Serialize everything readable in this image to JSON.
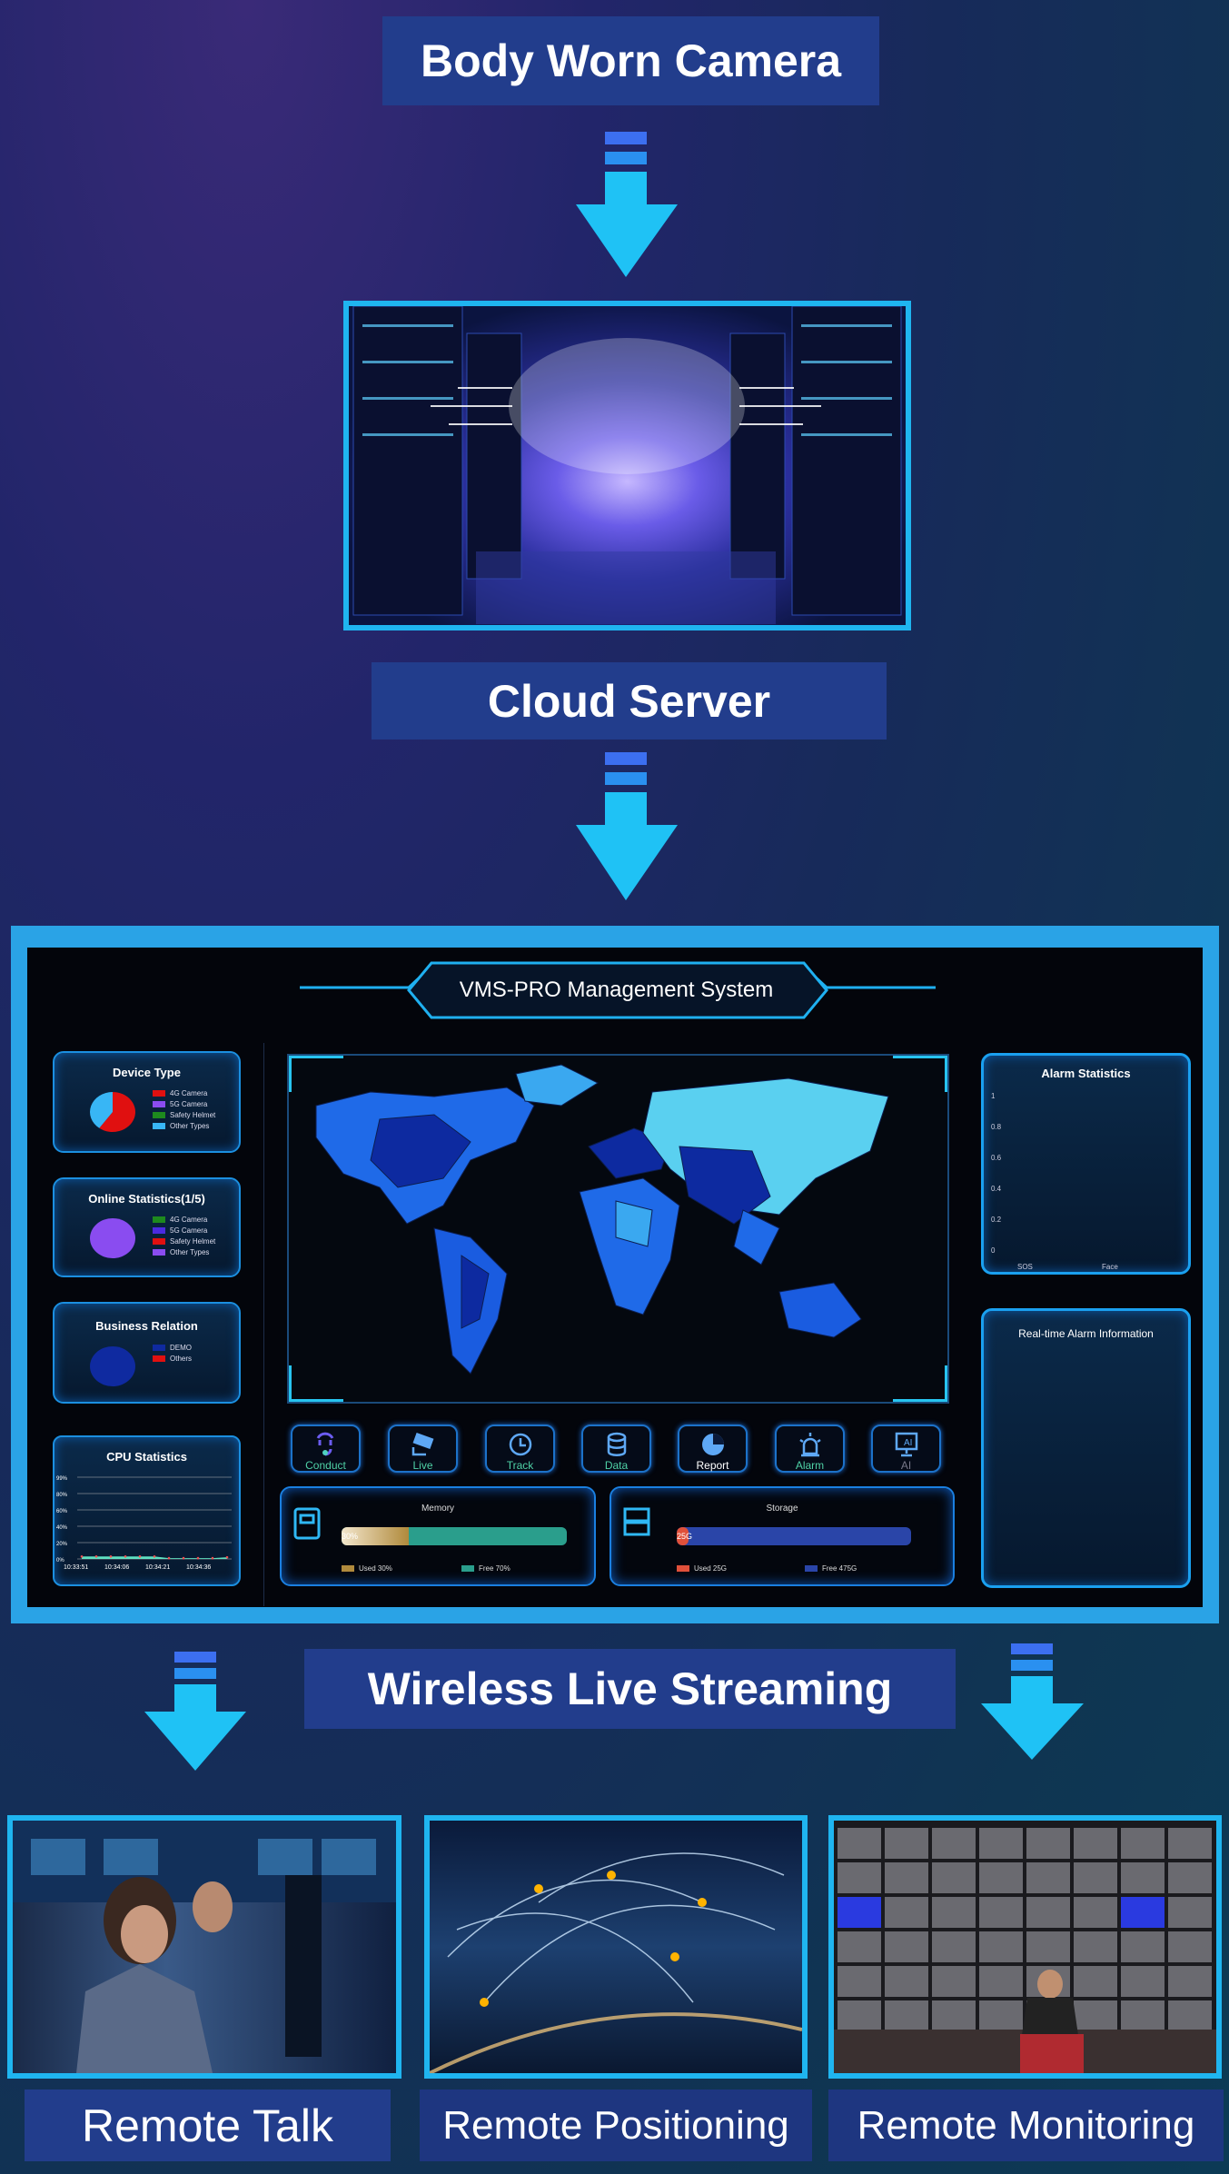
{
  "flow": {
    "step1": "Body Worn Camera",
    "step2": "Cloud Server",
    "step3": "Wireless Live Streaming",
    "outputs": [
      "Remote Talk",
      "Remote Positioning",
      "Remote Monitoring"
    ]
  },
  "dashboard": {
    "title": "VMS-PRO Management System",
    "device_type": {
      "title": "Device Type",
      "legend": [
        "4G Camera",
        "5G Camera",
        "Safety Helmet",
        "Other Types"
      ],
      "colors": [
        "#e01010",
        "#8a4cf0",
        "#1e8a1e",
        "#38b6f5"
      ],
      "values": [
        0.6,
        0,
        0,
        0.4
      ]
    },
    "online_stats": {
      "title": "Online Statistics(1/5)",
      "legend": [
        "4G Camera",
        "5G Camera",
        "Safety Helmet",
        "Other Types"
      ],
      "colors": [
        "#1e8a1e",
        "#4b2ae0",
        "#e01010",
        "#8a4cf0"
      ],
      "values": [
        0,
        0,
        0,
        1
      ]
    },
    "business": {
      "title": "Business Relation",
      "legend": [
        "DEMO",
        "Others"
      ],
      "colors": [
        "#0f2aa0",
        "#e01010"
      ],
      "values": [
        1,
        0
      ]
    },
    "cpu": {
      "title": "CPU Statistics",
      "y_ticks": [
        "99%",
        "80%",
        "60%",
        "40%",
        "20%",
        "0%"
      ],
      "x_ticks": [
        "10:33:51",
        "10:34:06",
        "10:34:21",
        "10:34:36"
      ],
      "values": [
        3,
        3,
        3,
        3,
        3,
        3,
        1,
        1,
        1,
        1,
        2
      ]
    },
    "nav": [
      {
        "label": "Conduct",
        "icon": "headset-icon"
      },
      {
        "label": "Live",
        "icon": "camera-icon"
      },
      {
        "label": "Track",
        "icon": "history-icon"
      },
      {
        "label": "Data",
        "icon": "database-icon"
      },
      {
        "label": "Report",
        "icon": "pie-icon"
      },
      {
        "label": "Alarm",
        "icon": "alarm-icon"
      },
      {
        "label": "AI",
        "icon": "ai-monitor-icon"
      }
    ],
    "memory": {
      "title": "Memory",
      "bar_label": "30%",
      "used_fraction": 0.3,
      "used": "Used 30%",
      "free": "Free 70%"
    },
    "storage": {
      "title": "Storage",
      "bar_label": "25G",
      "used_fraction": 0.05,
      "used": "Used 25G",
      "free": "Free 475G"
    },
    "alarm_stats": {
      "title": "Alarm Statistics",
      "y_ticks": [
        "1",
        "0.8",
        "0.6",
        "0.4",
        "0.2",
        "0"
      ],
      "categories": [
        "SOS",
        "Face"
      ]
    },
    "realtime": {
      "title": "Real-time Alarm Information"
    }
  }
}
